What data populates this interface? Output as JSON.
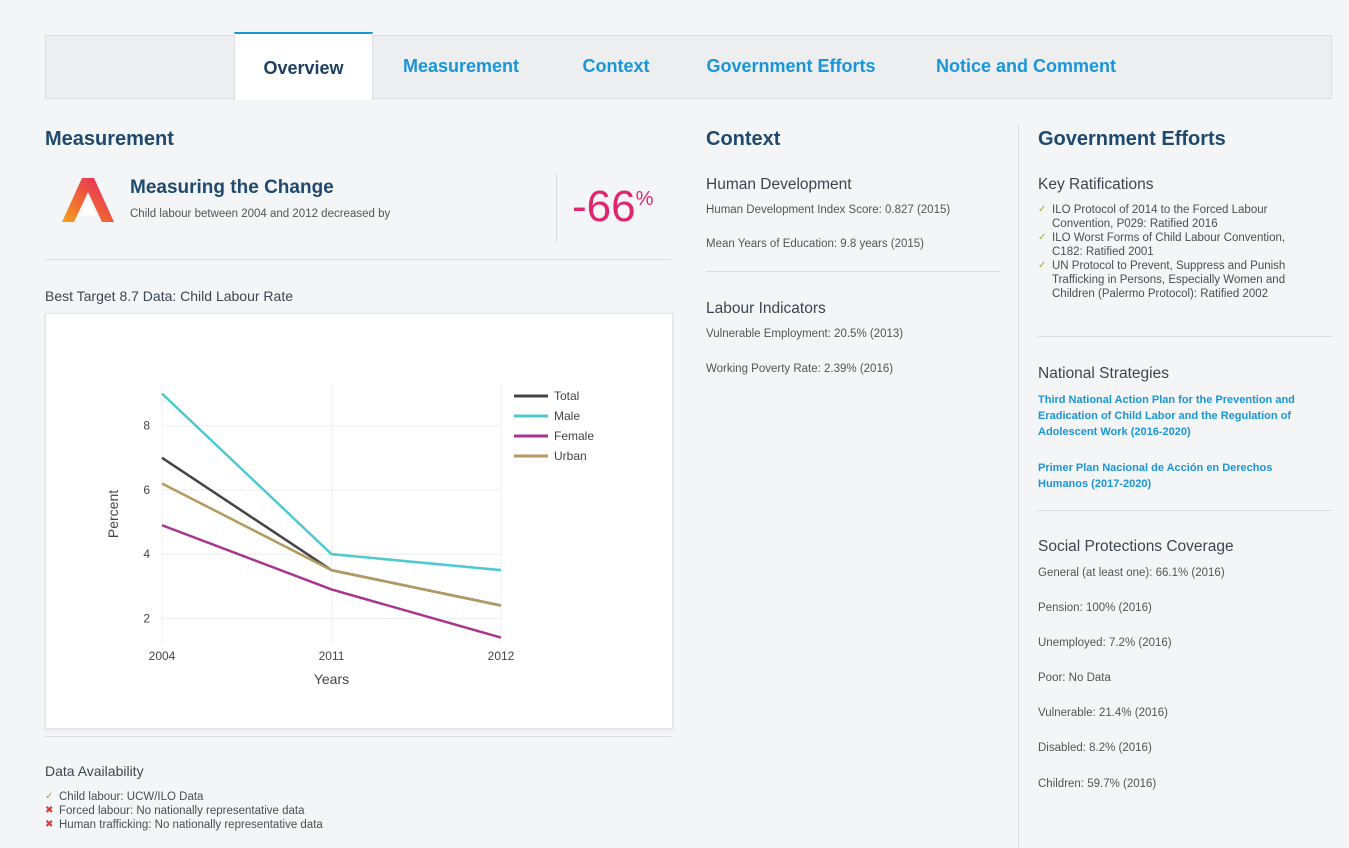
{
  "tabs": [
    "Overview",
    "Measurement",
    "Context",
    "Government Efforts",
    "Notice and Comment"
  ],
  "measurement": {
    "heading": "Measurement",
    "title": "Measuring the Change",
    "desc": "Child labour between 2004 and 2012 decreased by",
    "pct_value": "-66",
    "pct_unit": "%",
    "chart_heading": "Best Target 8.7 Data: Child Labour Rate"
  },
  "chart_data": {
    "type": "line",
    "x": [
      "2004",
      "2011",
      "2012"
    ],
    "xlabel": "Years",
    "ylabel": "Percent",
    "yticks": [
      "2",
      "4",
      "6",
      "8"
    ],
    "ylim": [
      1.2,
      9.3
    ],
    "grid": true,
    "legend_position": "top-right",
    "series": [
      {
        "name": "Total",
        "color": "#444444",
        "values": [
          7.0,
          3.5,
          2.4
        ]
      },
      {
        "name": "Male",
        "color": "#4ec9d0",
        "values": [
          9.0,
          4.0,
          3.5
        ]
      },
      {
        "name": "Female",
        "color": "#a8348f",
        "values": [
          4.9,
          2.9,
          1.4
        ]
      },
      {
        "name": "Urban",
        "color": "#b49a60",
        "values": [
          6.2,
          3.5,
          2.4
        ]
      }
    ]
  },
  "data_availability": {
    "heading": "Data Availability",
    "items": [
      {
        "icon": "check",
        "text": "Child labour: UCW/ILO Data"
      },
      {
        "icon": "cross",
        "text": "Forced labour: No nationally representative data"
      },
      {
        "icon": "cross",
        "text": "Human trafficking: No nationally representative data"
      }
    ]
  },
  "context": {
    "heading": "Context",
    "human_dev": {
      "title": "Human Development",
      "items": [
        "Human Development Index Score: 0.827 (2015)",
        "Mean Years of Education: 9.8 years (2015)"
      ]
    },
    "labour": {
      "title": "Labour Indicators",
      "items": [
        "Vulnerable Employment: 20.5% (2013)",
        "Working Poverty Rate: 2.39% (2016)"
      ]
    }
  },
  "government": {
    "heading": "Government Efforts",
    "ratifications_title": "Key Ratifications",
    "ratifications": [
      [
        "ILO Protocol of 2014 to the Forced Labour",
        "Convention, P029: Ratified 2016"
      ],
      [
        "ILO Worst Forms of Child Labour Convention,",
        "C182: Ratified 2001"
      ],
      [
        "UN Protocol to Prevent, Suppress and Punish",
        "Trafficking in Persons, Especially Women and",
        "Children (Palermo Protocol): Ratified 2002"
      ]
    ],
    "strategies_title": "National Strategies",
    "strategies": [
      [
        "Third National Action Plan for the Prevention and",
        "Eradication of Child Labor and the Regulation of",
        "Adolescent Work (2016-2020)"
      ],
      [
        "Primer Plan Nacional de Acción en Derechos",
        "Humanos (2017-2020)"
      ]
    ],
    "social_title": "Social Protections Coverage",
    "social": [
      "General (at least one): 66.1% (2016)",
      "Pension: 100% (2016)",
      "Unemployed: 7.2% (2016)",
      "Poor: No Data",
      "Vulnerable: 21.4% (2016)",
      "Disabled: 8.2% (2016)",
      "Children: 59.7% (2016)"
    ]
  }
}
